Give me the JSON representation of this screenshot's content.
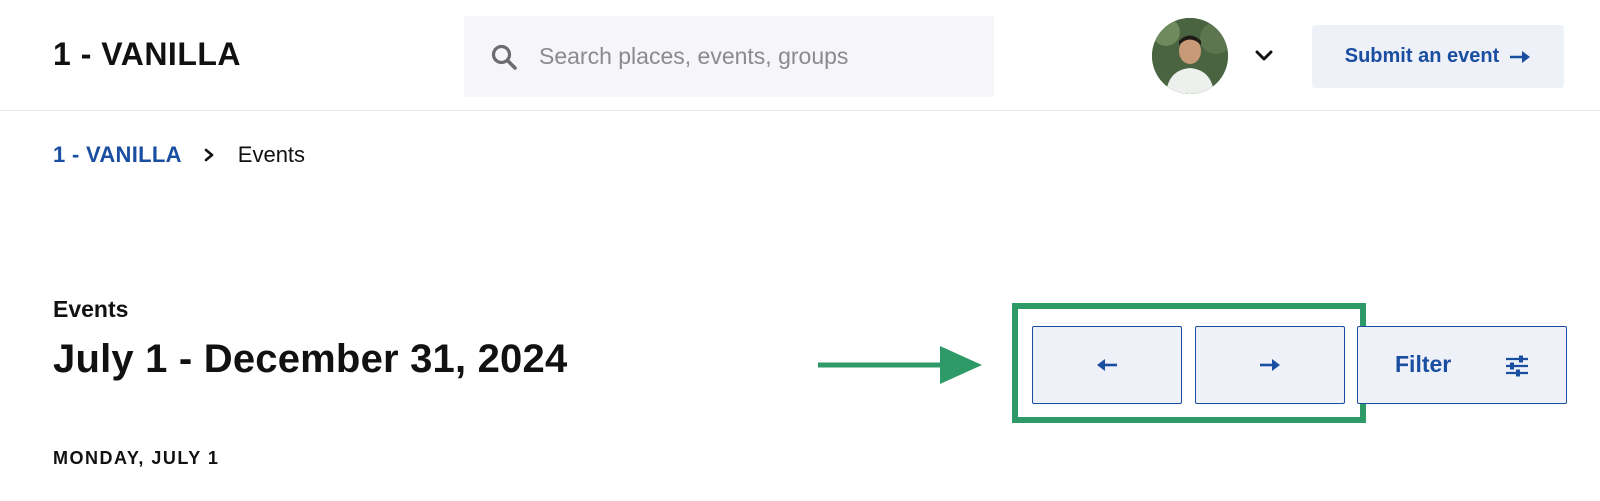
{
  "header": {
    "site_title": "1 - VANILLA",
    "search": {
      "placeholder": "Search places, events, groups",
      "value": ""
    },
    "submit_label": "Submit an event"
  },
  "breadcrumb": {
    "root": "1 - VANILLA",
    "current": "Events"
  },
  "main": {
    "section_label": "Events",
    "date_range": "July 1 - December 31, 2024",
    "day_heading": "MONDAY, JULY 1"
  },
  "controls": {
    "filter_label": "Filter"
  },
  "icons": {
    "search": "search-icon",
    "avatar_dropdown": "chevron-down-icon",
    "submit": "arrow-right-icon",
    "breadcrumb_sep": "chevron-right-icon",
    "prev": "arrow-left-icon",
    "next": "arrow-right-icon",
    "filter": "sliders-icon"
  },
  "colors": {
    "accent": "#1a4ea1",
    "button_bg": "#eef1f7",
    "annotation": "#2e9a67",
    "search_bg": "#f6f6f8"
  }
}
